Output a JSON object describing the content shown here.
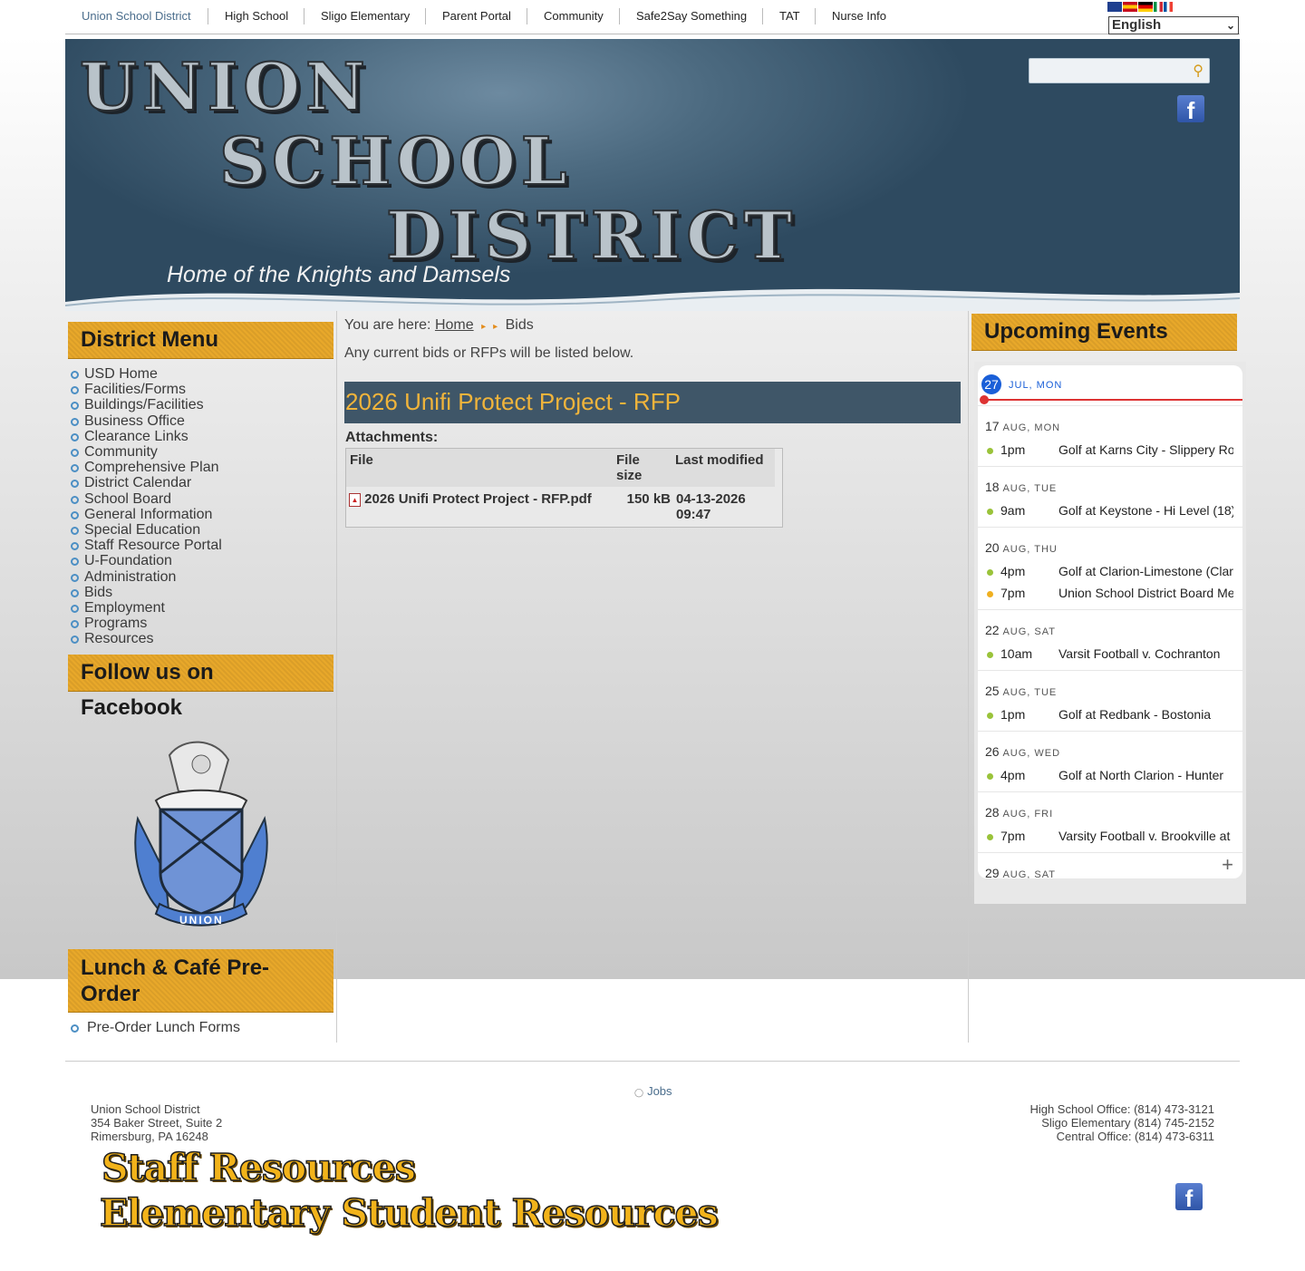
{
  "top_nav": {
    "items": [
      "Union School District",
      "High School",
      "Sligo Elementary",
      "Parent Portal",
      "Community",
      "Safe2Say Something",
      "TAT",
      "Nurse Info"
    ],
    "language": "English"
  },
  "header": {
    "line1": "UNION",
    "line2": "SCHOOL",
    "line3": "DISTRICT",
    "tagline": "Home of the Knights and Damsels",
    "facebook_glyph": "f"
  },
  "left": {
    "district_menu_title": "District Menu",
    "menu": [
      "USD Home",
      "Facilities/Forms",
      "Buildings/Facilities",
      "Business Office",
      "Clearance Links",
      "Community",
      "Comprehensive Plan",
      "District Calendar",
      "School Board",
      "General Information",
      "Special Education",
      "Staff Resource Portal",
      "U-Foundation",
      "Administration",
      "Bids",
      "Employment",
      "Programs",
      "Resources"
    ],
    "facebook_title": "Follow us on Facebook",
    "crest_text": "UNION",
    "lunch_title": "Lunch & Café Pre-Order",
    "lunch_link": "Pre-Order Lunch Forms"
  },
  "center": {
    "breadcrumb_prefix": "You are here:",
    "breadcrumb_home": "Home",
    "breadcrumb_current": "Bids",
    "intro": "Any current bids or RFPs will be listed below.",
    "bid_title": "2026 Unifi Protect Project - RFP",
    "attachments_label": "Attachments:",
    "table_headers": [
      "File",
      "File size",
      "Last modified"
    ],
    "attachment": {
      "file": "2026 Unifi Protect Project - RFP.pdf",
      "size": "150 kB",
      "modified": "04-13-2026 09:47"
    }
  },
  "right": {
    "title": "Upcoming Events",
    "today_num": "27",
    "today_label": "JUL, MON",
    "days": [
      {
        "num": "17",
        "label": "AUG, MON",
        "events": [
          {
            "time": "1pm",
            "title": "Golf at Karns City - Slippery Rock",
            "color": "#9ac33a"
          }
        ]
      },
      {
        "num": "18",
        "label": "AUG, TUE",
        "events": [
          {
            "time": "9am",
            "title": "Golf at Keystone - Hi Level (18)",
            "color": "#9ac33a"
          }
        ]
      },
      {
        "num": "20",
        "label": "AUG, THU",
        "events": [
          {
            "time": "4pm",
            "title": "Golf at Clarion-Limestone (Clarion)",
            "color": "#9ac33a"
          },
          {
            "time": "7pm",
            "title": "Union School District Board Meeting",
            "color": "#f0b020"
          }
        ]
      },
      {
        "num": "22",
        "label": "AUG, SAT",
        "events": [
          {
            "time": "10am",
            "title": "Varsit Football v. Cochranton",
            "color": "#9ac33a"
          }
        ]
      },
      {
        "num": "25",
        "label": "AUG, TUE",
        "events": [
          {
            "time": "1pm",
            "title": "Golf at Redbank - Bostonia",
            "color": "#9ac33a"
          }
        ]
      },
      {
        "num": "26",
        "label": "AUG, WED",
        "events": [
          {
            "time": "4pm",
            "title": "Golf at North Clarion - Hunter",
            "color": "#9ac33a"
          }
        ]
      },
      {
        "num": "28",
        "label": "AUG, FRI",
        "events": [
          {
            "time": "7pm",
            "title": "Varsity Football v. Brookville at",
            "color": "#9ac33a"
          }
        ]
      },
      {
        "num": "29",
        "label": "AUG, SAT",
        "events": []
      }
    ],
    "more_glyph": "+"
  },
  "footer": {
    "jobs": "Jobs",
    "address": [
      "Union School District",
      "354 Baker Street, Suite 2",
      "Rimersburg, PA 16248"
    ],
    "phones": [
      "High School Office: (814) 473-3121",
      "Sligo Elementary (814) 745-2152",
      "Central Office: (814) 473-6311"
    ],
    "staff_resources": "Staff Resources",
    "elementary_resources": "Elementary Student Resources"
  }
}
